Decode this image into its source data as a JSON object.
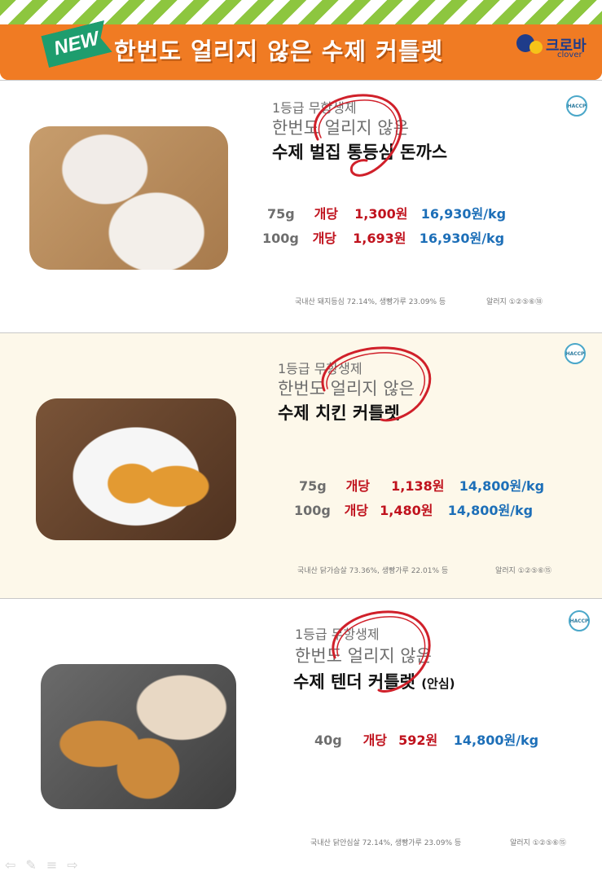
{
  "banner": {
    "new_label": "NEW",
    "title": "한번도 얼리지 않은 수제 커틀렛",
    "logo_text": "크로바",
    "logo_sub": "clover"
  },
  "badge": {
    "haccp": "HACCP"
  },
  "products": [
    {
      "grade": "1등급 무항생제",
      "subtitle": "한번도 얼리지 않은",
      "name": "수제 벌집 통등심 돈까스",
      "name_note": "",
      "prices": [
        {
          "weight": "75g",
          "unit": "개당",
          "amount": "1,300원",
          "per_kg": "16,930원/kg"
        },
        {
          "weight": "100g",
          "unit": "개당",
          "amount": "1,693원",
          "per_kg": "16,930원/kg"
        }
      ],
      "ingredients": "국내산 돼지등심 72.14%, 생빵가루 23.09% 등",
      "allergy": "알러지 ①②⑤⑥⑱"
    },
    {
      "grade": "1등급 무항생제",
      "subtitle": "한번도 얼리지 않은",
      "name": "수제 치킨 커틀렛",
      "name_note": "",
      "prices": [
        {
          "weight": "75g",
          "unit": "개당",
          "amount": "1,138원",
          "per_kg": "14,800원/kg"
        },
        {
          "weight": "100g",
          "unit": "개당",
          "amount": "1,480원",
          "per_kg": "14,800원/kg"
        }
      ],
      "ingredients": "국내산 닭가슴살 73.36%, 생빵가루 22.01% 등",
      "allergy": "알러지 ①②⑤⑥⑮"
    },
    {
      "grade": "1등급 무항생제",
      "subtitle": "한번도 얼리지 않은",
      "name": "수제 텐더 커틀렛",
      "name_note": "(안심)",
      "prices": [
        {
          "weight": "40g",
          "unit": "개당",
          "amount": "592원",
          "per_kg": "14,800원/kg"
        }
      ],
      "ingredients": "국내산 닭안심살 72.14%, 생빵가루 23.09% 등",
      "allergy": "알러지 ①②⑤⑥⑮"
    }
  ],
  "nav": {
    "prev_icon": "arrow-left-icon",
    "pen_icon": "pen-icon",
    "menu_icon": "menu-icon",
    "next_icon": "arrow-right-icon"
  },
  "colors": {
    "banner": "#f07b23",
    "stripe": "#8dc63f",
    "price_red": "#c0121d",
    "price_blue": "#1d6fb8",
    "circle_red": "#d0202a"
  }
}
